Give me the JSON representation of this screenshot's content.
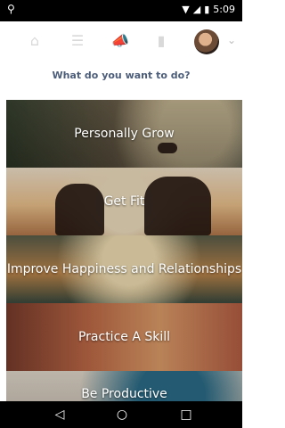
{
  "status_bar": {
    "time": "5:09",
    "left_icon": "location-pin-icon",
    "icons": [
      "wifi-icon",
      "signal-icon",
      "battery-icon"
    ]
  },
  "top_nav": {
    "icons": [
      "home-icon",
      "list-icon",
      "megaphone-icon",
      "bag-icon"
    ],
    "has_avatar": true,
    "more_icon": "chevron-down-icon"
  },
  "prompt": {
    "text": "What do you want to do?"
  },
  "tiles": [
    {
      "label": "Personally Grow"
    },
    {
      "label": "Get Fit"
    },
    {
      "label": "Improve Happiness and Relationships"
    },
    {
      "label": "Practice A Skill"
    },
    {
      "label": "Be Productive"
    }
  ],
  "bottom_nav": {
    "icons": [
      "back-icon",
      "home-circle-icon",
      "recents-icon"
    ]
  }
}
